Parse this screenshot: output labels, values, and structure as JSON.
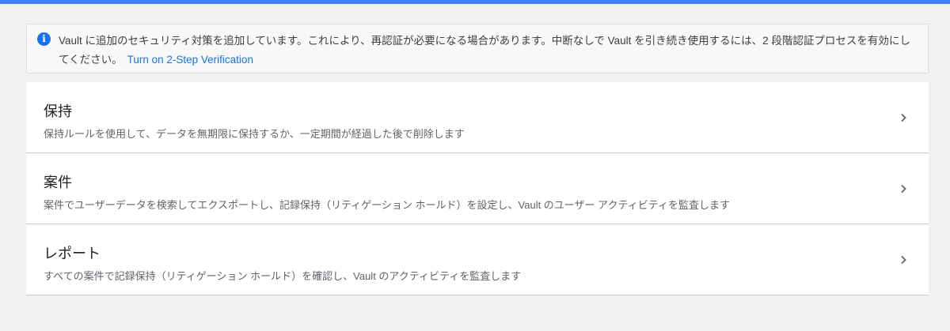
{
  "banner": {
    "icon": "info-icon",
    "icon_color": "#1a73e8",
    "message": "Vault に追加のセキュリティ対策を追加しています。これにより、再認証が必要になる場合があります。中断なしで Vault を引き続き使用するには、2 段階認証プロセスを有効にしてください。",
    "link_label": "Turn on 2-Step Verification"
  },
  "cards": [
    {
      "title": "保持",
      "description": "保持ルールを使用して、データを無期限に保持するか、一定期間が経過した後で削除します",
      "icon": "chevron-right-icon"
    },
    {
      "title": "案件",
      "description": "案件でユーザーデータを検索してエクスポートし、記録保持（リティゲーション ホールド）を設定し、Vault のユーザー アクティビティを監査します",
      "icon": "chevron-right-icon"
    },
    {
      "title": "レポート",
      "description": "すべての案件で記録保持（リティゲーション ホールド）を確認し、Vault のアクティビティを監査します",
      "icon": "chevron-right-icon"
    }
  ],
  "colors": {
    "top_bar": "#4285f4",
    "link": "#1a73e8",
    "background": "#f1f1f1"
  }
}
